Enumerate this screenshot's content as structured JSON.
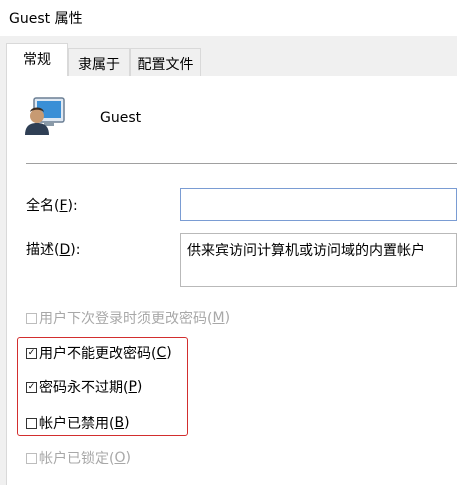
{
  "window": {
    "title": "Guest 属性"
  },
  "tabs": [
    {
      "label": "常规"
    },
    {
      "label": "隶属于"
    },
    {
      "label": "配置文件"
    }
  ],
  "user": {
    "name": "Guest",
    "icon": "user-account-icon"
  },
  "fields": {
    "full_name": {
      "label_pre": "全名(",
      "accel": "F",
      "label_post": "):",
      "value": ""
    },
    "description": {
      "label_pre": "描述(",
      "accel": "D",
      "label_post": "):",
      "value": "供来宾访问计算机或访问域的内置帐户"
    }
  },
  "options": [
    {
      "label_pre": "用户下次登录时须更改密码(",
      "accel": "M",
      "label_post": ")",
      "checked": false,
      "enabled": false
    },
    {
      "label_pre": "用户不能更改密码(",
      "accel": "C",
      "label_post": ")",
      "checked": true,
      "enabled": true
    },
    {
      "label_pre": "密码永不过期(",
      "accel": "P",
      "label_post": ")",
      "checked": true,
      "enabled": true
    },
    {
      "label_pre": "帐户已禁用(",
      "accel": "B",
      "label_post": ")",
      "checked": false,
      "enabled": true
    },
    {
      "label_pre": "帐户已锁定(",
      "accel": "O",
      "label_post": ")",
      "checked": false,
      "enabled": false
    }
  ],
  "colors": {
    "highlight": "#d22e2e",
    "input_border": "#7a9cd3"
  }
}
